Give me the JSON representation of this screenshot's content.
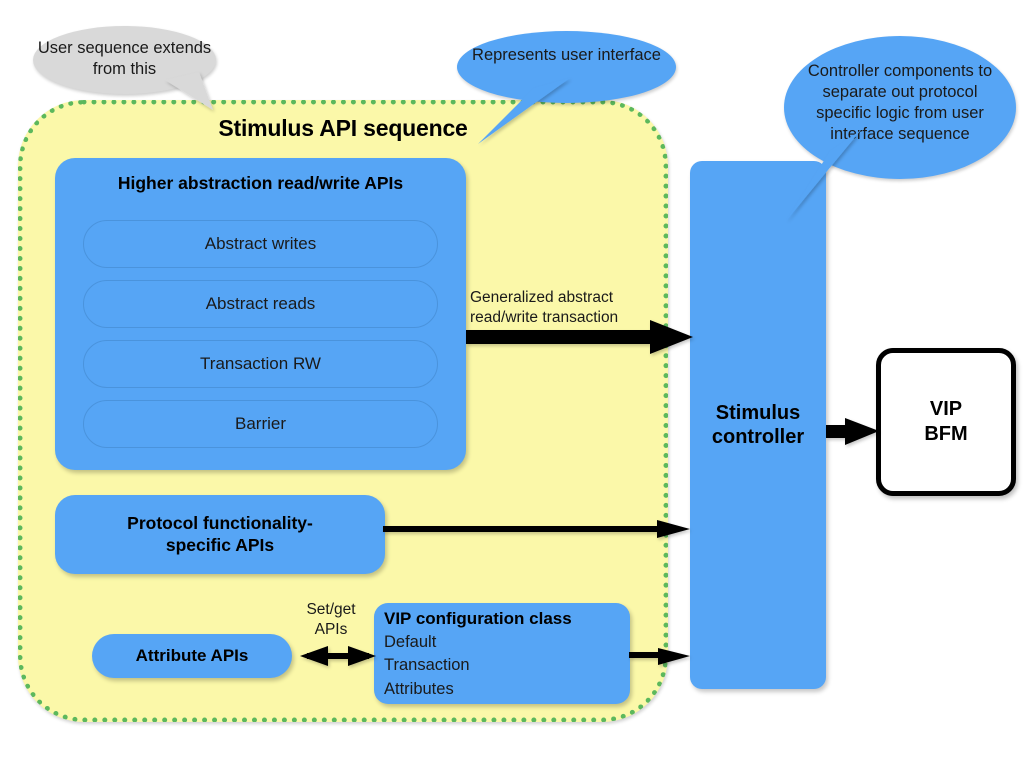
{
  "diagram": {
    "title": "Stimulus API sequence",
    "callouts": [
      {
        "id": "user-sequence",
        "text": "User sequence extends from this",
        "color": "#d9d9d9"
      },
      {
        "id": "user-interface",
        "text": "Represents user interface",
        "color": "#56a5f5"
      },
      {
        "id": "controller-components",
        "text": "Controller components to separate out protocol specific logic from user interface sequence",
        "color": "#56a5f5"
      }
    ],
    "higher_abstraction": {
      "title": "Higher abstraction read/write APIs",
      "items": [
        "Abstract writes",
        "Abstract reads",
        "Transaction RW",
        "Barrier"
      ]
    },
    "protocol_apis": {
      "label": "Protocol functionality-\nspecific APIs",
      "line1": "Protocol functionality-",
      "line2": "specific APIs"
    },
    "attribute_apis": {
      "label": "Attribute APIs"
    },
    "vip_config": {
      "title": "VIP configuration class",
      "lines": [
        "Default",
        "Transaction",
        "Attributes"
      ]
    },
    "stimulus_controller": {
      "line1": "Stimulus",
      "line2": "controller"
    },
    "vip_bfm": {
      "line1": "VIP",
      "line2": "BFM"
    },
    "arrow_labels": {
      "generalized_line1": "Generalized abstract",
      "generalized_line2": "read/write transaction",
      "setget_line1": "Set/get",
      "setget_line2": "APIs"
    },
    "colors": {
      "blue": "#56a5f5",
      "yellow": "#fbf8a9",
      "green_dotted": "#5cb85c",
      "gray_callout": "#d9d9d9",
      "black": "#000000",
      "white": "#ffffff"
    }
  }
}
